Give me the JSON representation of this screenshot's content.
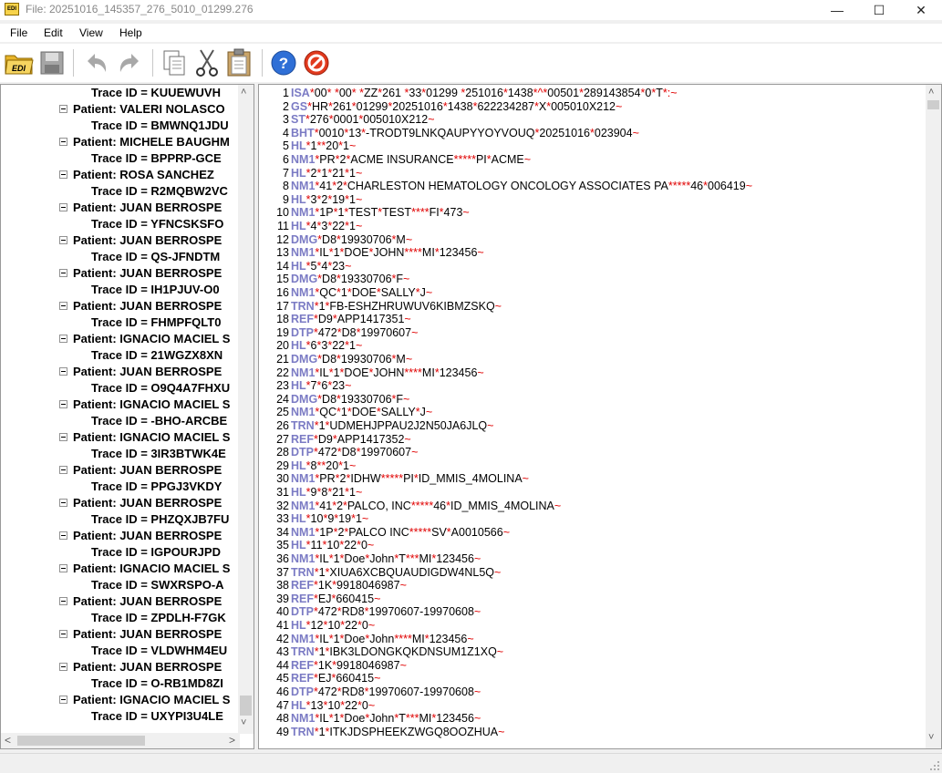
{
  "window": {
    "title": "File: 20251016_145357_276_5010_01299.276",
    "app_icon_text": "EDI",
    "minimize_glyph": "—",
    "maximize_glyph": "☐",
    "close_glyph": "✕"
  },
  "menu": [
    "File",
    "Edit",
    "View",
    "Help"
  ],
  "toolbar": [
    "open-edi-icon",
    "save-icon",
    "undo-icon",
    "redo-icon",
    "copy-icon",
    "cut-icon",
    "paste-icon",
    "help-icon",
    "stop-icon"
  ],
  "tree": [
    {
      "type": "trace",
      "text": "Trace ID = KUUEWUVH"
    },
    {
      "type": "patient",
      "text": "Patient: VALERI NOLASCO"
    },
    {
      "type": "trace",
      "text": "Trace ID = BMWNQ1JDU"
    },
    {
      "type": "patient",
      "text": "Patient: MICHELE BAUGHM"
    },
    {
      "type": "trace",
      "text": "Trace ID = BPPRP-GCE"
    },
    {
      "type": "patient",
      "text": "Patient: ROSA SANCHEZ"
    },
    {
      "type": "trace",
      "text": "Trace ID = R2MQBW2VC"
    },
    {
      "type": "patient",
      "text": "Patient: JUAN BERROSPE"
    },
    {
      "type": "trace",
      "text": "Trace ID = YFNCSKSFO"
    },
    {
      "type": "patient",
      "text": "Patient: JUAN BERROSPE"
    },
    {
      "type": "trace",
      "text": "Trace ID = QS-JFNDTM"
    },
    {
      "type": "patient",
      "text": "Patient: JUAN BERROSPE"
    },
    {
      "type": "trace",
      "text": "Trace ID = IH1PJUV-O0"
    },
    {
      "type": "patient",
      "text": "Patient: JUAN BERROSPE"
    },
    {
      "type": "trace",
      "text": "Trace ID = FHMPFQLT0"
    },
    {
      "type": "patient",
      "text": "Patient: IGNACIO MACIEL S"
    },
    {
      "type": "trace",
      "text": "Trace ID = 21WGZX8XN"
    },
    {
      "type": "patient",
      "text": "Patient: JUAN BERROSPE"
    },
    {
      "type": "trace",
      "text": "Trace ID = O9Q4A7FHXU"
    },
    {
      "type": "patient",
      "text": "Patient: IGNACIO MACIEL S"
    },
    {
      "type": "trace",
      "text": "Trace ID = -BHO-ARCBE"
    },
    {
      "type": "patient",
      "text": "Patient: IGNACIO MACIEL S"
    },
    {
      "type": "trace",
      "text": "Trace ID = 3IR3BTWK4E"
    },
    {
      "type": "patient",
      "text": "Patient: JUAN BERROSPE"
    },
    {
      "type": "trace",
      "text": "Trace ID = PPGJ3VKDY"
    },
    {
      "type": "patient",
      "text": "Patient: JUAN BERROSPE"
    },
    {
      "type": "trace",
      "text": "Trace ID = PHZQXJB7FU"
    },
    {
      "type": "patient",
      "text": "Patient: JUAN BERROSPE"
    },
    {
      "type": "trace",
      "text": "Trace ID = IGPOURJPD"
    },
    {
      "type": "patient",
      "text": "Patient: IGNACIO MACIEL S"
    },
    {
      "type": "trace",
      "text": "Trace ID = SWXRSPO-A"
    },
    {
      "type": "patient",
      "text": "Patient: JUAN BERROSPE"
    },
    {
      "type": "trace",
      "text": "Trace ID = ZPDLH-F7GK"
    },
    {
      "type": "patient",
      "text": "Patient: JUAN BERROSPE"
    },
    {
      "type": "trace",
      "text": "Trace ID = VLDWHM4EU"
    },
    {
      "type": "patient",
      "text": "Patient: JUAN BERROSPE"
    },
    {
      "type": "trace",
      "text": "Trace ID = O-RB1MD8ZI"
    },
    {
      "type": "patient",
      "text": "Patient: IGNACIO MACIEL S"
    },
    {
      "type": "trace",
      "text": "Trace ID = UXYPI3U4LE"
    }
  ],
  "tree_scroll": {
    "up_glyph": "˄",
    "down_glyph": "˅",
    "left_glyph": "<",
    "right_glyph": ">"
  },
  "editor": {
    "lines": [
      {
        "n": "1",
        "text": "ISA*00*          *00*          *ZZ*261            *33*01299          *251016*1438*^*00501*289143854*0*T*:~"
      },
      {
        "n": "2",
        "text": "GS*HR*261*01299*20251016*1438*622234287*X*005010X212~"
      },
      {
        "n": "3",
        "text": "ST*276*0001*005010X212~"
      },
      {
        "n": "4",
        "text": "BHT*0010*13*-TRODT9LNKQAUPYYOYVOUQ*20251016*023904~"
      },
      {
        "n": "5",
        "text": "HL*1**20*1~"
      },
      {
        "n": "6",
        "text": "NM1*PR*2*ACME INSURANCE*****PI*ACME~"
      },
      {
        "n": "7",
        "text": "HL*2*1*21*1~"
      },
      {
        "n": "8",
        "text": "NM1*41*2*CHARLESTON HEMATOLOGY ONCOLOGY ASSOCIATES PA*****46*006419~"
      },
      {
        "n": "9",
        "text": "HL*3*2*19*1~"
      },
      {
        "n": "10",
        "text": "NM1*1P*1*TEST*TEST****FI*473~"
      },
      {
        "n": "11",
        "text": "HL*4*3*22*1~"
      },
      {
        "n": "12",
        "text": "DMG*D8*19930706*M~"
      },
      {
        "n": "13",
        "text": "NM1*IL*1*DOE*JOHN****MI*123456~"
      },
      {
        "n": "14",
        "text": "HL*5*4*23~"
      },
      {
        "n": "15",
        "text": "DMG*D8*19330706*F~"
      },
      {
        "n": "16",
        "text": "NM1*QC*1*DOE*SALLY*J~"
      },
      {
        "n": "17",
        "text": "TRN*1*FB-ESHZHRUWUV6KIBMZSKQ~"
      },
      {
        "n": "18",
        "text": "REF*D9*APP1417351~"
      },
      {
        "n": "19",
        "text": "DTP*472*D8*19970607~"
      },
      {
        "n": "20",
        "text": "HL*6*3*22*1~"
      },
      {
        "n": "21",
        "text": "DMG*D8*19930706*M~"
      },
      {
        "n": "22",
        "text": "NM1*IL*1*DOE*JOHN****MI*123456~"
      },
      {
        "n": "23",
        "text": "HL*7*6*23~"
      },
      {
        "n": "24",
        "text": "DMG*D8*19330706*F~"
      },
      {
        "n": "25",
        "text": "NM1*QC*1*DOE*SALLY*J~"
      },
      {
        "n": "26",
        "text": "TRN*1*UDMEHJPPAU2J2N50JA6JLQ~"
      },
      {
        "n": "27",
        "text": "REF*D9*APP1417352~"
      },
      {
        "n": "28",
        "text": "DTP*472*D8*19970607~"
      },
      {
        "n": "29",
        "text": "HL*8**20*1~"
      },
      {
        "n": "30",
        "text": "NM1*PR*2*IDHW*****PI*ID_MMIS_4MOLINA~"
      },
      {
        "n": "31",
        "text": "HL*9*8*21*1~"
      },
      {
        "n": "32",
        "text": "NM1*41*2*PALCO, INC*****46*ID_MMIS_4MOLINA~"
      },
      {
        "n": "33",
        "text": "HL*10*9*19*1~"
      },
      {
        "n": "34",
        "text": "NM1*1P*2*PALCO INC*****SV*A0010566~"
      },
      {
        "n": "35",
        "text": "HL*11*10*22*0~"
      },
      {
        "n": "36",
        "text": "NM1*IL*1*Doe*John*T***MI*123456~"
      },
      {
        "n": "37",
        "text": "TRN*1*XIUA6XCBQUAUDIGDW4NL5Q~"
      },
      {
        "n": "38",
        "text": "REF*1K*9918046987~"
      },
      {
        "n": "39",
        "text": "REF*EJ*660415~"
      },
      {
        "n": "40",
        "text": "DTP*472*RD8*19970607-19970608~"
      },
      {
        "n": "41",
        "text": "HL*12*10*22*0~"
      },
      {
        "n": "42",
        "text": "NM1*IL*1*Doe*John****MI*123456~"
      },
      {
        "n": "43",
        "text": "TRN*1*IBK3LDONGKQKDNSUM1Z1XQ~"
      },
      {
        "n": "44",
        "text": "REF*1K*9918046987~"
      },
      {
        "n": "45",
        "text": "REF*EJ*660415~"
      },
      {
        "n": "46",
        "text": "DTP*472*RD8*19970607-19970608~"
      },
      {
        "n": "47",
        "text": "HL*13*10*22*0~"
      },
      {
        "n": "48",
        "text": "NM1*IL*1*Doe*John*T***MI*123456~"
      },
      {
        "n": "49",
        "text": "TRN*1*ITKJDSPHEEKZWGQ8OOZHUA~"
      }
    ]
  },
  "colors": {
    "segment": "#7b7bc4",
    "delimiter": "#e00000",
    "text": "#000000"
  }
}
